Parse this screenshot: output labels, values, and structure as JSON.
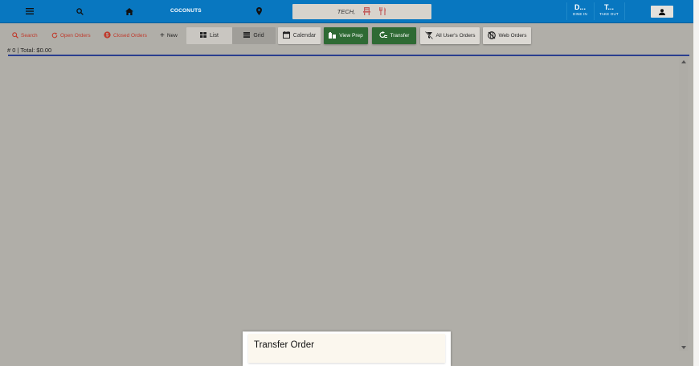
{
  "topbar": {
    "brand": "COCONUTS",
    "center_label": "TECH,",
    "modes": [
      {
        "big": "D...",
        "small": "DINE IN"
      },
      {
        "big": "T...",
        "small": "TAKE OUT"
      }
    ],
    "icons": [
      "menu-icon",
      "search-icon",
      "home-icon",
      "location-pin-icon",
      "chair-icon",
      "utensils-icon",
      "person-icon"
    ]
  },
  "toolbar": {
    "search": "Search",
    "open_orders": "Open Orders",
    "closed_orders": "Closed Orders",
    "new": "New",
    "list": "List",
    "grid": "Grid",
    "calendar": "Calendar",
    "view_prep": "View Prep",
    "transfer": "Transfer",
    "all_users_orders": "All User's Orders",
    "web_orders": "Web Orders"
  },
  "summary": {
    "totals": "# 0 | Total: $0.00"
  },
  "dialog": {
    "title": "Transfer Order"
  },
  "colors": {
    "topbar": "#0877c0",
    "accent_green": "#2e6a34",
    "accent_red": "#c0392b",
    "divider": "#2a3f8f",
    "background": "#b0aea8"
  }
}
